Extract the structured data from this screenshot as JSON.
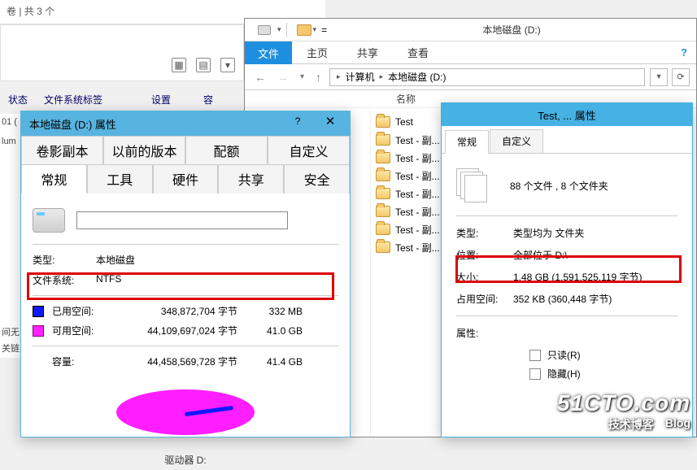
{
  "background": {
    "top_row": "卷 | 共 3 个",
    "left_frag1": "01 (",
    "left_frag2": "lum",
    "left_frag3": "间无",
    "left_frag4": "关链",
    "col_state": "状态",
    "col_fslabel": "文件系统标签",
    "col_settings": "设置",
    "col_cap": "容"
  },
  "dlg1": {
    "title": "本地磁盘 (D:) 属性",
    "win_help": "?",
    "win_close": "✕",
    "tabs_row1": [
      "卷影副本",
      "以前的版本",
      "配额",
      "自定义"
    ],
    "tabs_row2": [
      "常规",
      "工具",
      "硬件",
      "共享",
      "安全"
    ],
    "type_label": "类型:",
    "type_value": "本地磁盘",
    "fs_label": "文件系统:",
    "fs_value": "NTFS",
    "used_label": "已用空间:",
    "used_bytes": "348,872,704 字节",
    "used_h": "332 MB",
    "free_label": "可用空间:",
    "free_bytes": "44,109,697,024 字节",
    "free_h": "41.0 GB",
    "cap_label": "容量:",
    "cap_bytes": "44,458,569,728 字节",
    "cap_h": "41.4 GB",
    "pie_caption": "驱动器 D:"
  },
  "explorer": {
    "title": "本地磁盘 (D:)",
    "file_tab": "文件",
    "tab_home": "主页",
    "tab_share": "共享",
    "tab_view": "查看",
    "path_computer": "计算机",
    "path_drive": "本地磁盘 (D:)",
    "col_name": "名称",
    "folders": [
      "Test",
      "Test - 副...",
      "Test - 副...",
      "Test - 副...",
      "Test - 副...",
      "Test - 副...",
      "Test - 副...",
      "Test - 副..."
    ]
  },
  "dlg2": {
    "title": "Test, ... 属性",
    "tab_general": "常规",
    "tab_custom": "自定义",
    "summary": "88 个文件 , 8 个文件夹",
    "type_label": "类型:",
    "type_value": "类型均为 文件夹",
    "loc_label": "位置:",
    "loc_value": "全部位于 D:\\",
    "size_label": "大小:",
    "size_value": "1.48 GB (1,591,525,119 字节)",
    "ondisk_label": "占用空间:",
    "ondisk_value": "352 KB (360,448 字节)",
    "attr_label": "属性:",
    "chk_readonly": "只读(R)",
    "chk_hidden": "隐藏(H)"
  },
  "watermark": {
    "line1": "51CTO.com",
    "line2a": "技术博客",
    "line2b": "Blog"
  }
}
